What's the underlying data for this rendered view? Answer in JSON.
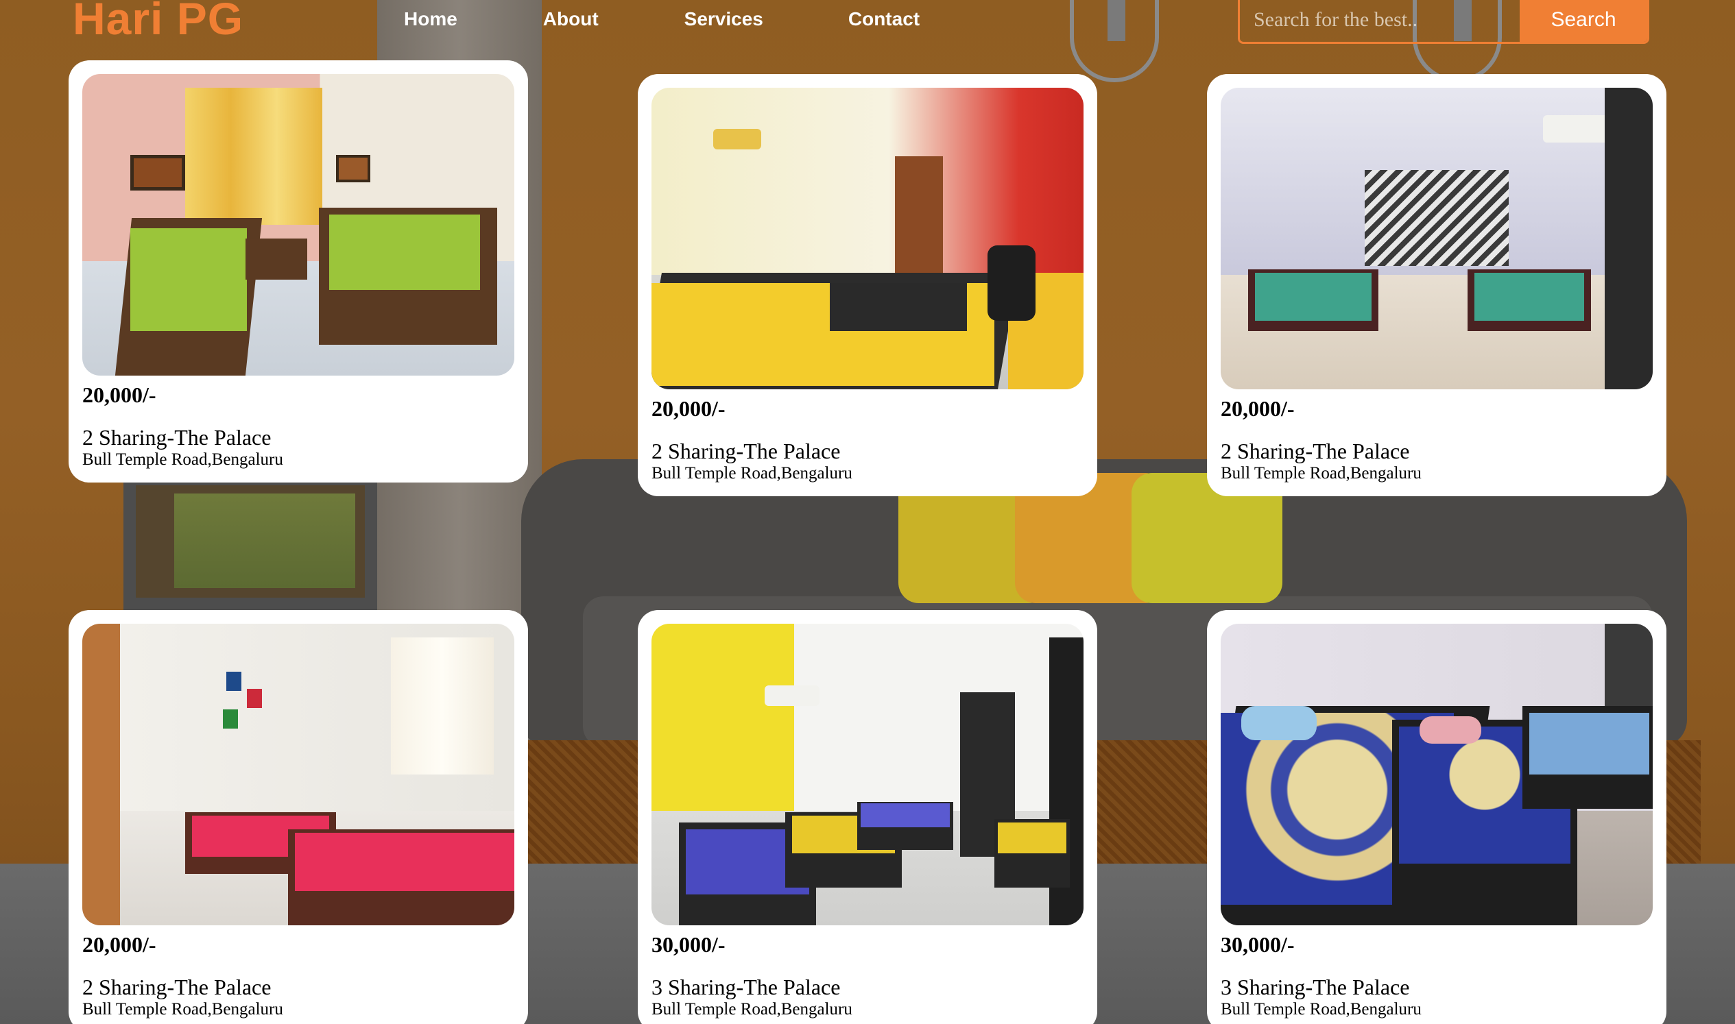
{
  "header": {
    "logo": "Hari PG",
    "nav": [
      "Home",
      "About",
      "Services",
      "Contact"
    ],
    "search_placeholder": "Search for the best..",
    "search_button": "Search"
  },
  "colors": {
    "accent": "#f07f34",
    "card_bg": "#ffffff"
  },
  "listings": [
    {
      "price": "20,000/-",
      "title": "2 Sharing-The Palace",
      "address": "Bull Temple Road,Bengaluru"
    },
    {
      "price": "20,000/-",
      "title": "2 Sharing-The Palace",
      "address": "Bull Temple Road,Bengaluru"
    },
    {
      "price": "20,000/-",
      "title": "2 Sharing-The Palace",
      "address": "Bull Temple Road,Bengaluru"
    },
    {
      "price": "20,000/-",
      "title": "2 Sharing-The Palace",
      "address": "Bull Temple Road,Bengaluru"
    },
    {
      "price": "30,000/-",
      "title": "3 Sharing-The Palace",
      "address": "Bull Temple Road,Bengaluru"
    },
    {
      "price": "30,000/-",
      "title": "3 Sharing-The Palace",
      "address": "Bull Temple Road,Bengaluru"
    }
  ]
}
